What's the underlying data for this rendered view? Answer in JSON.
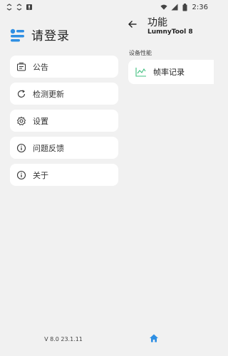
{
  "status_bar": {
    "time": "2:36",
    "left_icons": [
      "sync-icon",
      "sync-icon",
      "notification-icon"
    ],
    "right_icons": [
      "wifi-icon",
      "signal-icon",
      "battery-icon"
    ]
  },
  "drawer": {
    "login_text": "请登录",
    "menu_items": [
      {
        "label": "公告",
        "icon": "announcement-icon"
      },
      {
        "label": "检测更新",
        "icon": "refresh-icon"
      },
      {
        "label": "设置",
        "icon": "gear-icon"
      },
      {
        "label": "问题反馈",
        "icon": "info-icon"
      },
      {
        "label": "关于",
        "icon": "info-icon"
      }
    ],
    "version": "V 8.0 23.1.11"
  },
  "panel": {
    "title": "功能",
    "subtitle": "LumnyTool 8",
    "section_label": "设备性能",
    "card_label": "帧率记录",
    "accent_color": "#2f8fe3",
    "chart_icon_color": "#3fbf7f"
  }
}
